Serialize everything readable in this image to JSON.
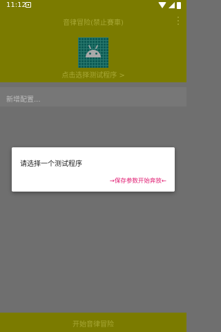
{
  "status_bar": {
    "time": "11:12"
  },
  "app": {
    "title": "音律冒险(禁止賽車)",
    "select_link": "点击选择测试程序 >",
    "icon": "android-icon"
  },
  "config": {
    "new_config_label": "新增配置..."
  },
  "dialog": {
    "message": "请选择一个测试程序",
    "action_label": "→保存参数开始奔放←"
  },
  "bottom": {
    "label": "开始音律冒险"
  },
  "colors": {
    "header_bg": "#7b7b00",
    "overlay_bg": "#6f6f6f",
    "action_text": "#e01e73"
  }
}
